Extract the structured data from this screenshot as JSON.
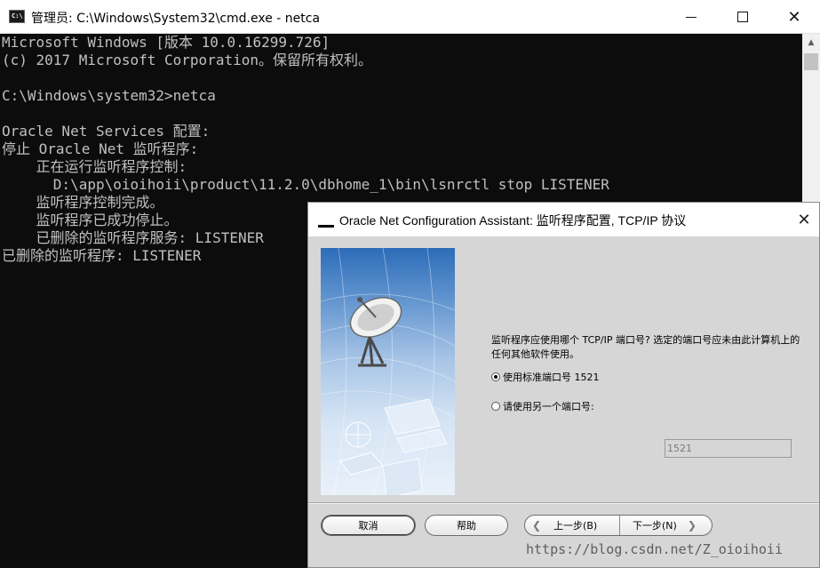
{
  "window": {
    "title": "管理员: C:\\Windows\\System32\\cmd.exe - netca",
    "icon": "C:\\",
    "controls": {
      "minimize_icon": "minimize-icon",
      "maximize_icon": "maximize-icon",
      "close_icon": "close-icon"
    }
  },
  "console": {
    "lines": [
      "Microsoft Windows [版本 10.0.16299.726]",
      "(c) 2017 Microsoft Corporation。保留所有权利。",
      "",
      "C:\\Windows\\system32>netca",
      "",
      "Oracle Net Services 配置:",
      "停止 Oracle Net 监听程序:",
      "    正在运行监听程序控制:",
      "      D:\\app\\oioihoii\\product\\11.2.0\\dbhome_1\\bin\\lsnrctl stop LISTENER",
      "    监听程序控制完成。",
      "    监听程序已成功停止。",
      "    已删除的监听程序服务: LISTENER",
      "已删除的监听程序: LISTENER"
    ]
  },
  "dialog": {
    "title": "Oracle Net Configuration Assistant: 监听程序配置, TCP/IP 协议",
    "instructions": "监听程序应使用哪个 TCP/IP 端口号? 选定的端口号应未由此计算机上的任何其他软件使用。",
    "options": [
      {
        "label": "使用标准端口号 1521",
        "checked": true
      },
      {
        "label": "请使用另一个端口号:",
        "checked": false
      }
    ],
    "port_value": "1521",
    "buttons": {
      "cancel": "取消",
      "help": "帮助",
      "back": "上一步(B)",
      "next": "下一步(N)"
    },
    "colors": {
      "background": "#d6d6d6",
      "panel_top": "#2d6cb8"
    }
  },
  "watermark": "https://blog.csdn.net/Z_oioihoii"
}
